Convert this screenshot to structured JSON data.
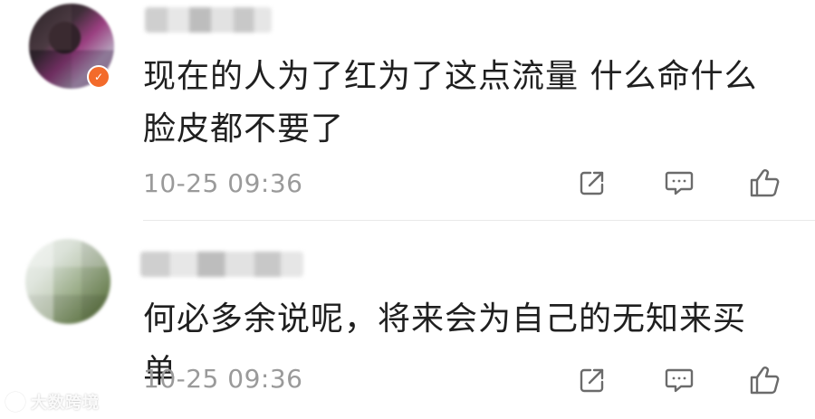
{
  "comments": [
    {
      "text": "现在的人为了红为了这点流量 什么命什么\n脸皮都不要了",
      "timestamp": "10-25 09:36",
      "badge": "✓"
    },
    {
      "text": "何必多余说呢，将来会为自己的无知来买单",
      "timestamp": "10-25 09:36"
    }
  ],
  "icons": {
    "share": "share-icon",
    "comment": "comment-icon",
    "like": "thumbs-up-icon"
  },
  "watermark": {
    "text": "大数跨境"
  },
  "colors": {
    "text": "#1f1f1f",
    "muted": "#9a9a9a",
    "badge": "#f36b2b",
    "divider": "#e9e9e9"
  }
}
